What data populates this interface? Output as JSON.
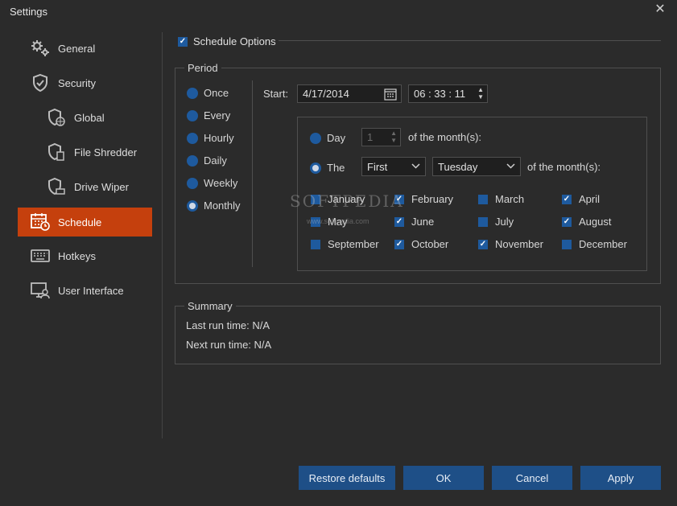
{
  "window": {
    "title": "Settings",
    "close_glyph": "✕"
  },
  "sidebar": {
    "items": [
      {
        "label": "General",
        "icon": "gears-icon"
      },
      {
        "label": "Security",
        "icon": "shield-icon"
      },
      {
        "label": "Global",
        "icon": "shield-globe-icon"
      },
      {
        "label": "File Shredder",
        "icon": "shield-file-icon"
      },
      {
        "label": "Drive Wiper",
        "icon": "shield-drive-icon"
      },
      {
        "label": "Schedule",
        "icon": "calendar-clock-icon",
        "active": true
      },
      {
        "label": "Hotkeys",
        "icon": "keyboard-icon"
      },
      {
        "label": "User Interface",
        "icon": "monitor-user-icon"
      }
    ]
  },
  "schedule_options": {
    "label": "Schedule Options",
    "checked": true
  },
  "period": {
    "legend": "Period",
    "frequency_options": [
      {
        "label": "Once",
        "selected": false
      },
      {
        "label": "Every",
        "selected": false
      },
      {
        "label": "Hourly",
        "selected": false
      },
      {
        "label": "Daily",
        "selected": false
      },
      {
        "label": "Weekly",
        "selected": false
      },
      {
        "label": "Monthly",
        "selected": true
      }
    ],
    "start_label": "Start:",
    "start_date": "4/17/2014",
    "start_time": "06 : 33 : 11",
    "monthly": {
      "day_option": {
        "label": "Day",
        "value": "1",
        "suffix": "of the month(s):",
        "selected": false
      },
      "the_option": {
        "label": "The",
        "ordinal": "First",
        "weekday": "Tuesday",
        "suffix": "of the month(s):",
        "selected": true
      },
      "months": [
        {
          "label": "January",
          "checked": false
        },
        {
          "label": "February",
          "checked": true
        },
        {
          "label": "March",
          "checked": false
        },
        {
          "label": "April",
          "checked": true
        },
        {
          "label": "May",
          "checked": false
        },
        {
          "label": "June",
          "checked": true
        },
        {
          "label": "July",
          "checked": false
        },
        {
          "label": "August",
          "checked": true
        },
        {
          "label": "September",
          "checked": false
        },
        {
          "label": "October",
          "checked": true
        },
        {
          "label": "November",
          "checked": true
        },
        {
          "label": "December",
          "checked": false
        }
      ]
    }
  },
  "summary": {
    "legend": "Summary",
    "last_run": "Last run time: N/A",
    "next_run": "Next run time: N/A"
  },
  "buttons": {
    "restore": "Restore defaults",
    "ok": "OK",
    "cancel": "Cancel",
    "apply": "Apply"
  },
  "watermark": {
    "text": "SOFTPEDIA",
    "url": "www.softpedia.com"
  },
  "colors": {
    "accent": "#c5400d",
    "button": "#1e4f87",
    "control": "#1e5a9e",
    "background": "#2b2b2b"
  }
}
